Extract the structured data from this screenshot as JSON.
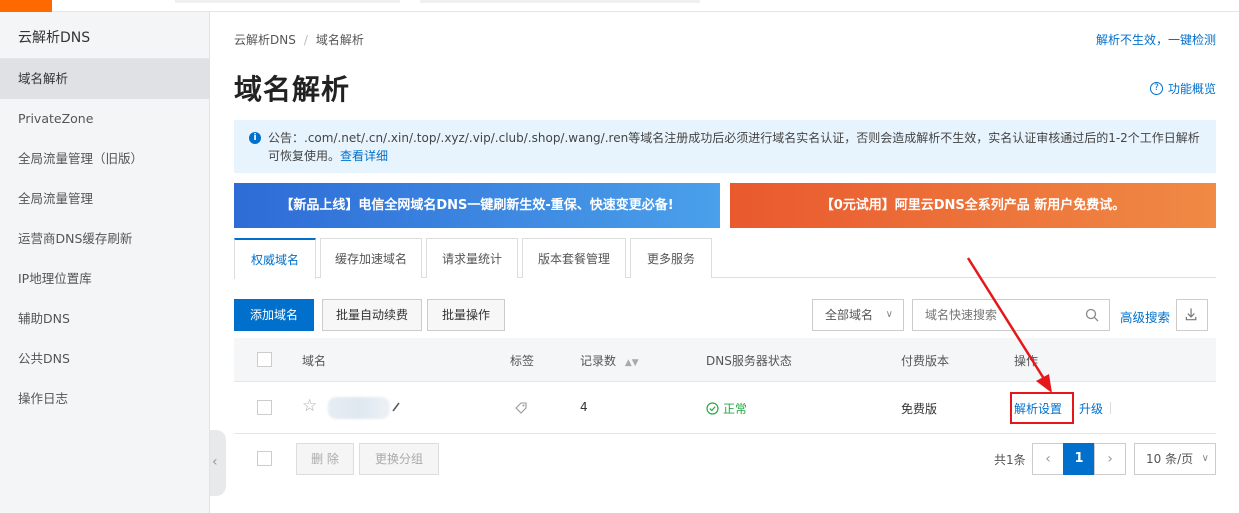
{
  "sidebar": {
    "title": "云解析DNS",
    "items": [
      {
        "label": "域名解析",
        "active": true
      },
      {
        "label": "PrivateZone"
      },
      {
        "label": "全局流量管理（旧版）"
      },
      {
        "label": "全局流量管理"
      },
      {
        "label": "运营商DNS缓存刷新"
      },
      {
        "label": "IP地理位置库"
      },
      {
        "label": "辅助DNS"
      },
      {
        "label": "公共DNS"
      },
      {
        "label": "操作日志"
      }
    ],
    "collapse_glyph": "‹"
  },
  "breadcrumb": {
    "root": "云解析DNS",
    "separator": "/",
    "current": "域名解析"
  },
  "header": {
    "top_link": "解析不生效，一键检测",
    "title": "域名解析",
    "overview_label": "功能概览"
  },
  "notice": {
    "text": "公告：.com/.net/.cn/.xin/.top/.xyz/.vip/.club/.shop/.wang/.ren等域名注册成功后必须进行域名实名认证，否则会造成解析不生效，实名认证审核通过后的1-2个工作日解析可恢复使用。",
    "link": "查看详细"
  },
  "banners": {
    "left": "【新品上线】电信全网域名DNS一键刷新生效-重保、快速变更必备!",
    "right": "【0元试用】阿里云DNS全系列产品 新用户免费试。"
  },
  "tabs": [
    "权威域名",
    "缓存加速域名",
    "请求量统计",
    "版本套餐管理",
    "更多服务"
  ],
  "toolbar": {
    "add": "添加域名",
    "batch_renew": "批量自动续费",
    "batch_ops": "批量操作",
    "filter_value": "全部域名",
    "search_placeholder": "域名快速搜索",
    "advanced": "高级搜索"
  },
  "table": {
    "headers": {
      "domain": "域名",
      "tag": "标签",
      "records": "记录数",
      "dns_status": "DNS服务器状态",
      "edition": "付费版本",
      "actions": "操作"
    },
    "rows": [
      {
        "records": "4",
        "status": "正常",
        "edition": "免费版",
        "action_primary": "解析设置",
        "action_secondary": "升级"
      }
    ]
  },
  "footer": {
    "delete": "删 除",
    "change_group": "更换分组",
    "total": "共1条",
    "page": "1",
    "page_size": "10 条/页"
  },
  "colors": {
    "accent": "#0070cc",
    "highlight": "#e5171a",
    "brand": "#ff6a00",
    "ok": "#28a745"
  }
}
